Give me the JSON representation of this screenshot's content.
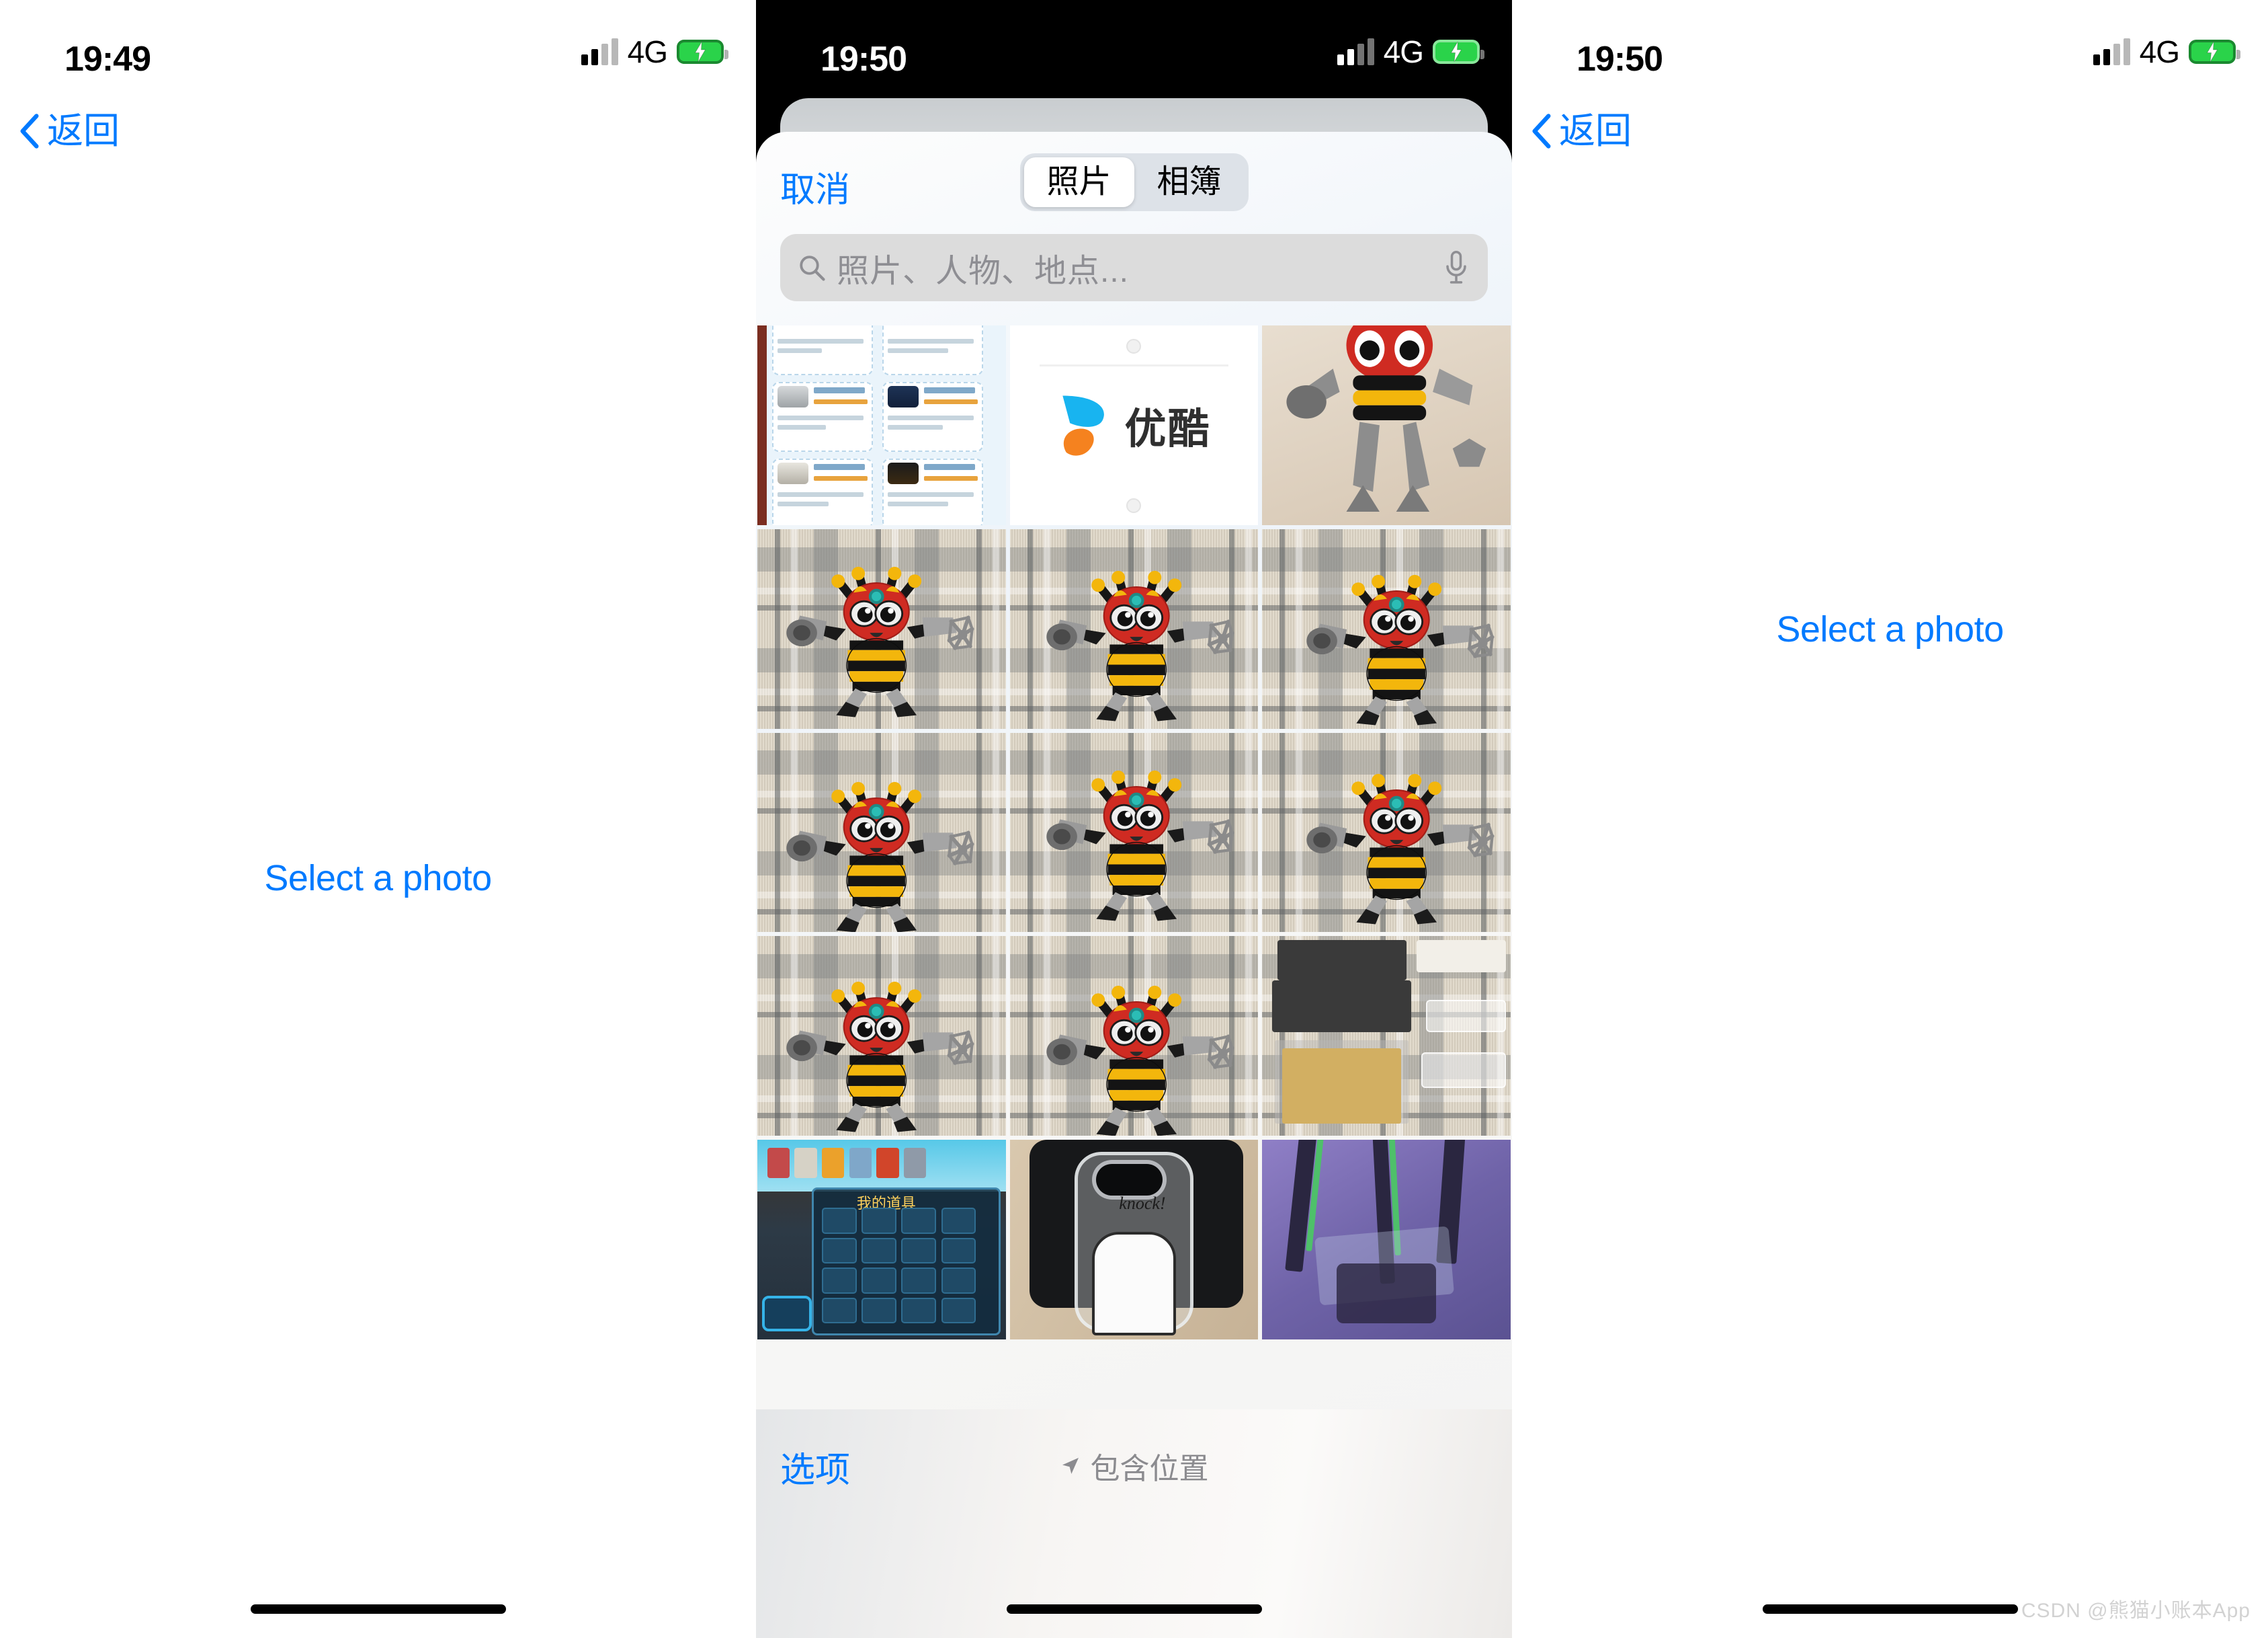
{
  "panels": {
    "left": {
      "status": {
        "time": "19:49",
        "network": "4G",
        "battery_state": "charging"
      },
      "nav": {
        "back_label": "返回",
        "back_icon": "chevron-left-icon"
      },
      "select_photo_label": "Select a photo"
    },
    "middle": {
      "status": {
        "time": "19:50",
        "network": "4G",
        "battery_state": "charging"
      },
      "sheet": {
        "cancel_label": "取消",
        "segmented": {
          "options": [
            "照片",
            "相簿"
          ],
          "selected": "照片"
        },
        "search": {
          "placeholder": "照片、人物、地点...",
          "icon": "search-icon",
          "mic_icon": "microphone-icon"
        },
        "footer": {
          "options_label": "选项",
          "include_location_label": "包含位置",
          "location_icon": "location-arrow-icon"
        },
        "grid": [
          {
            "name": "thumbnail-document-list",
            "kind": "doclist"
          },
          {
            "name": "thumbnail-youku-logo",
            "kind": "youku",
            "brand": "优酷"
          },
          {
            "name": "thumbnail-bee-robot-legs",
            "kind": "toy-legs"
          },
          {
            "name": "thumbnail-bee-robot-1",
            "kind": "toy"
          },
          {
            "name": "thumbnail-bee-robot-2",
            "kind": "toy"
          },
          {
            "name": "thumbnail-bee-robot-3",
            "kind": "toy"
          },
          {
            "name": "thumbnail-bee-robot-4",
            "kind": "toy"
          },
          {
            "name": "thumbnail-bee-robot-5",
            "kind": "toy"
          },
          {
            "name": "thumbnail-bee-robot-6",
            "kind": "toy"
          },
          {
            "name": "thumbnail-bee-robot-7",
            "kind": "toy"
          },
          {
            "name": "thumbnail-bee-robot-8",
            "kind": "toy"
          },
          {
            "name": "thumbnail-model-kit-sprue",
            "kind": "sprue"
          },
          {
            "name": "thumbnail-game-inventory",
            "kind": "game",
            "caption": "我的道具"
          },
          {
            "name": "thumbnail-phone-case",
            "kind": "phonecase",
            "caption": "knock!"
          },
          {
            "name": "thumbnail-anime-mecha",
            "kind": "eva"
          }
        ]
      }
    },
    "right": {
      "status": {
        "time": "19:50",
        "network": "4G",
        "battery_state": "charging"
      },
      "nav": {
        "back_label": "返回",
        "back_icon": "chevron-left-icon"
      },
      "select_photo_label": "Select a photo",
      "preview_name": "selected-photo-preview"
    }
  },
  "watermark": "CSDN @熊猫小账本App",
  "colors": {
    "accent_blue": "#007aff",
    "battery_green": "#2ad34a",
    "sheet_bg": "#f4f6f8",
    "search_field": "#dcdcdc",
    "placeholder_gray": "#8e8e93"
  }
}
